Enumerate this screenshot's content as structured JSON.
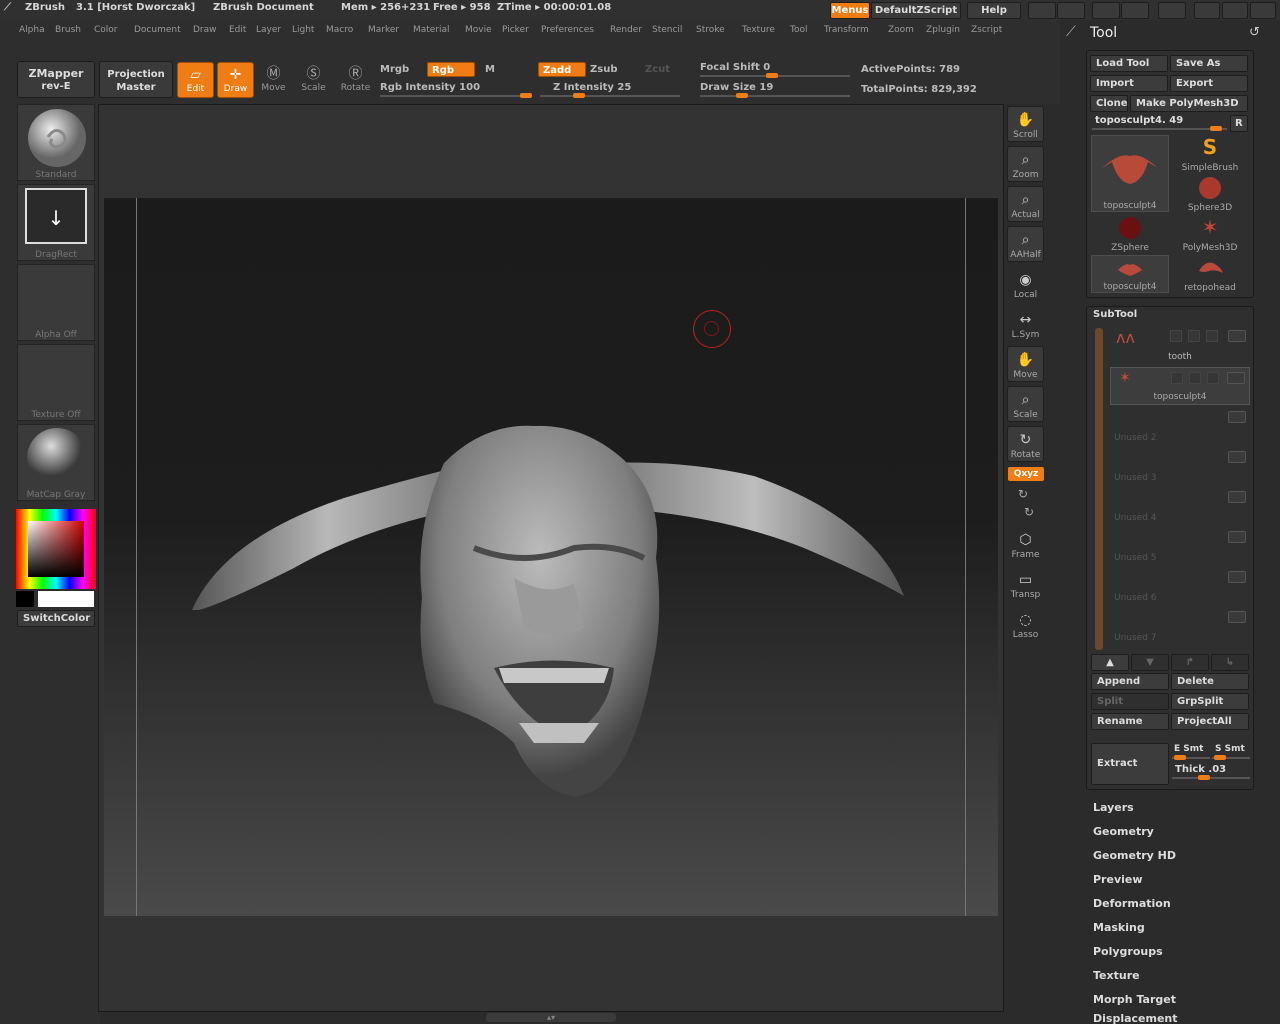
{
  "app": {
    "name": "ZBrush",
    "version_user": "3.1 [Horst Dworczak]",
    "document": "ZBrush Document",
    "mem": "Mem ▸ 256+231",
    "free": "Free ▸ 958",
    "ztime": "ZTime ▸ 00:00:01.08",
    "menus_btn": "Menus",
    "script_btn": "DefaultZScript",
    "help_btn": "Help"
  },
  "menubar": [
    "Alpha",
    "Brush",
    "Color",
    "Document",
    "Draw",
    "Edit",
    "Layer",
    "Light",
    "Macro",
    "Marker",
    "Material",
    "Movie",
    "Picker",
    "Preferences",
    "Render",
    "Stencil",
    "Stroke",
    "Texture",
    "Tool",
    "Transform",
    "Zoom",
    "Zplugin",
    "Zscript"
  ],
  "shelf": {
    "zmapper_line1": "ZMapper",
    "zmapper_line2": "rev-E",
    "projection_line1": "Projection",
    "projection_line2": "Master",
    "edit": "Edit",
    "draw": "Draw",
    "move": "Move",
    "scale": "Scale",
    "rotate": "Rotate",
    "mrgb": "Mrgb",
    "rgb": "Rgb",
    "m": "M",
    "rgb_intensity": "Rgb Intensity 100",
    "zadd": "Zadd",
    "zsub": "Zsub",
    "zcut": "Zcut",
    "z_intensity": "Z Intensity 25",
    "focal_shift": "Focal Shift 0",
    "draw_size": "Draw Size 19",
    "active_points": "ActivePoints: 789",
    "total_points": "TotalPoints: 829,392"
  },
  "left": {
    "brush": "Standard",
    "stroke": "DragRect",
    "alpha": "Alpha  Off",
    "texture": "Texture  Off",
    "material": "MatCap  Gray",
    "switch_color": "SwitchColor"
  },
  "nav": {
    "scroll": "Scroll",
    "zoom": "Zoom",
    "actual": "Actual",
    "aahalf": "AAHalf",
    "local": "Local",
    "lsym": "L.Sym",
    "move": "Move",
    "scale": "Scale",
    "rotate": "Rotate",
    "xyz": "Qxyz",
    "frame": "Frame",
    "transp": "Transp",
    "lasso": "Lasso"
  },
  "tool": {
    "title": "Tool",
    "load_tool": "Load Tool",
    "save_as": "Save As",
    "import": "Import",
    "export": "Export",
    "clone": "Clone",
    "make_polymesh": "Make PolyMesh3D",
    "current": "toposculpt4. 49",
    "r": "R",
    "tools": [
      {
        "name": "toposculpt4"
      },
      {
        "name": "SimpleBrush"
      },
      {
        "name": "Sphere3D"
      },
      {
        "name": "ZSphere"
      },
      {
        "name": "PolyMesh3D"
      },
      {
        "name": "toposculpt4"
      },
      {
        "name": "retopohead"
      }
    ],
    "subtool_title": "SubTool",
    "subtools": [
      "tooth",
      "toposculpt4",
      "Unused 2",
      "Unused 3",
      "Unused 4",
      "Unused 5",
      "Unused 6",
      "Unused 7"
    ],
    "append": "Append",
    "delete": "Delete",
    "split": "Split",
    "grpsplit": "GrpSplit",
    "rename": "Rename",
    "projectall": "ProjectAll",
    "extract": "Extract",
    "esmt": "E Smt",
    "ssmt": "S Smt",
    "thick": "Thick .03",
    "sections": [
      "Layers",
      "Geometry",
      "Geometry HD",
      "Preview",
      "Deformation",
      "Masking",
      "Polygroups",
      "Texture",
      "Morph Target",
      "Displacement"
    ]
  },
  "colors": {
    "accent": "#f07c14",
    "panel": "#2e2e2e",
    "model": "#8a8a8a"
  }
}
